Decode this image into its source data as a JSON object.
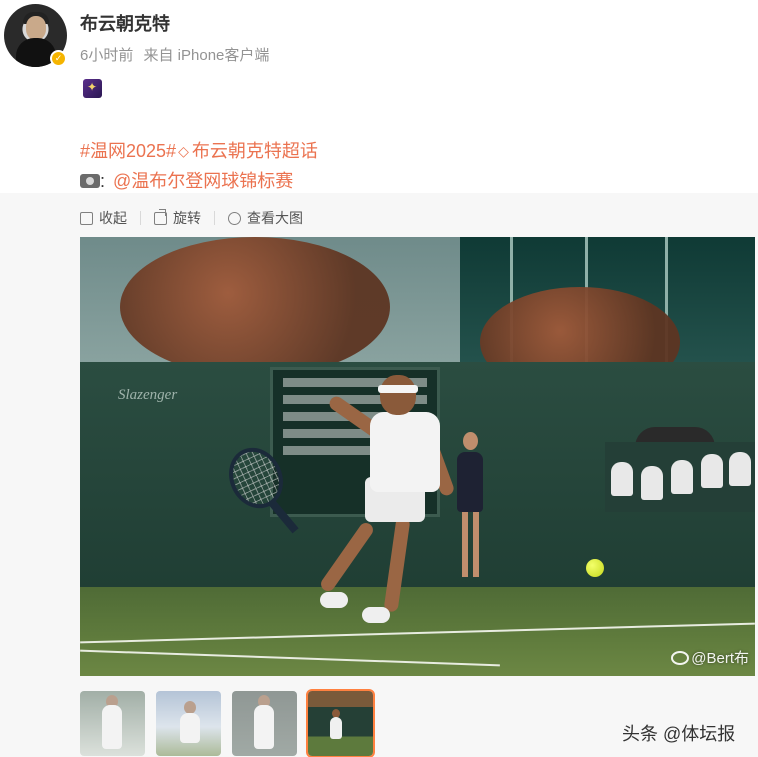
{
  "post": {
    "author": "布云朝克特",
    "time": "6小时前",
    "source": "来自 iPhone客户端",
    "hashtag": "#温网2025#",
    "super_topic": "布云朝克特超话",
    "mention_prefix": ":",
    "mention": "@温布尔登网球锦标赛"
  },
  "media_toolbar": {
    "collapse_label": "收起",
    "rotate_label": "旋转",
    "view_large_label": "查看大图"
  },
  "photo": {
    "watermark": "@Bert布",
    "board_brand": "Slazenger"
  },
  "thumbnails": {
    "count": 4,
    "active_index": 3
  },
  "footer": {
    "source_credit": "头条 @体坛报"
  },
  "colors": {
    "link": "#eb7350",
    "meta": "#939393",
    "active_thumb_border": "#ff8140",
    "verified_badge": "#f5b400"
  },
  "icons": [
    "verified-badge-icon",
    "emoji-badge-icon",
    "diamond-icon",
    "camera-icon",
    "collapse-icon",
    "rotate-icon",
    "zoom-icon",
    "weibo-logo-icon"
  ]
}
